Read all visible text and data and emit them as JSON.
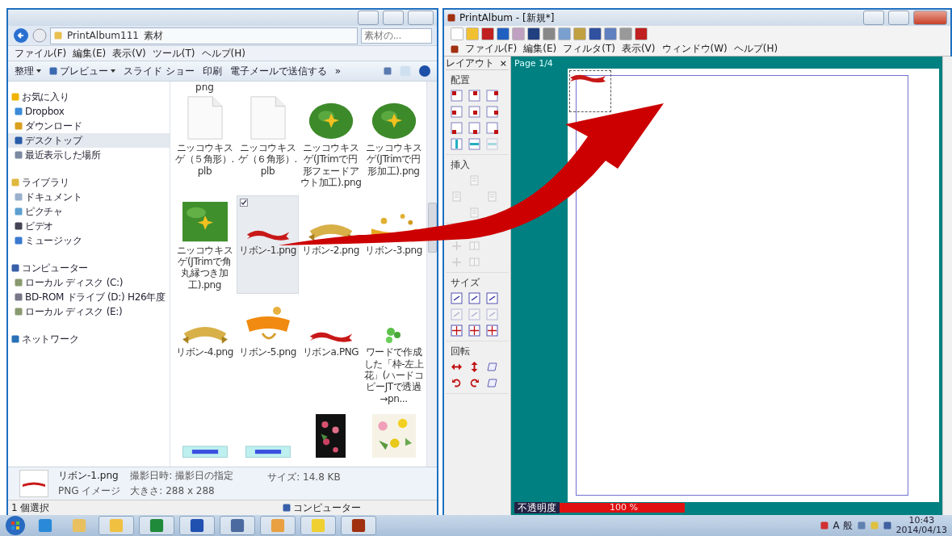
{
  "explorer": {
    "breadcrumb": [
      "PrintAlbum111",
      "素材"
    ],
    "search": {
      "placeholder": "素材の..."
    },
    "menu": [
      "ファイル(F)",
      "編集(E)",
      "表示(V)",
      "ツール(T)",
      "ヘルプ(H)"
    ],
    "commands": [
      {
        "label": "整理",
        "dropdown": true,
        "icon": false
      },
      {
        "label": "プレビュー",
        "dropdown": true,
        "icon": true
      },
      {
        "label": "スライド ショー",
        "dropdown": false,
        "icon": false
      },
      {
        "label": "印刷",
        "dropdown": false,
        "icon": false
      },
      {
        "label": "電子メールで送信する",
        "dropdown": false,
        "icon": false
      },
      {
        "label": "»",
        "dropdown": false,
        "icon": false
      }
    ],
    "nav": [
      {
        "label": "お気に入り",
        "kind": "star",
        "selected": false,
        "children": [
          {
            "label": "Dropbox",
            "kind": "dropbox",
            "selected": false
          },
          {
            "label": "ダウンロード",
            "kind": "download",
            "selected": false
          },
          {
            "label": "デスクトップ",
            "kind": "desktop",
            "selected": true
          },
          {
            "label": "最近表示した場所",
            "kind": "recent",
            "selected": false
          }
        ]
      },
      {
        "label": "ライブラリ",
        "kind": "library",
        "selected": false,
        "children": [
          {
            "label": "ドキュメント",
            "kind": "doc",
            "selected": false
          },
          {
            "label": "ピクチャ",
            "kind": "pic",
            "selected": false
          },
          {
            "label": "ビデオ",
            "kind": "video",
            "selected": false
          },
          {
            "label": "ミュージック",
            "kind": "music",
            "selected": false
          }
        ]
      },
      {
        "label": "コンピューター",
        "kind": "computer",
        "selected": false,
        "children": [
          {
            "label": "ローカル ディスク (C:)",
            "kind": "disk",
            "selected": false
          },
          {
            "label": "BD-ROM ドライブ (D:) H26年度",
            "kind": "bd",
            "selected": false
          },
          {
            "label": "ローカル ディスク (E:)",
            "kind": "disk",
            "selected": false
          }
        ]
      },
      {
        "label": "ネットワーク",
        "kind": "network",
        "selected": false
      }
    ],
    "partial_label": "png",
    "files": [
      {
        "name": "ニッコウキスゲ（５角形）.plb",
        "kind": "document",
        "selected": false
      },
      {
        "name": "ニッコウキスゲ（６角形）.plb",
        "kind": "document",
        "selected": false
      },
      {
        "name": "ニッコウキスゲ(JTrimで円形フェードアウト加工).png",
        "kind": "photo-oval",
        "selected": false
      },
      {
        "name": "ニッコウキスゲ(JTrimで円形加工).png",
        "kind": "photo-oval",
        "selected": false
      },
      {
        "name": "ニッコウキスゲ(JTrimで角丸縁つき加工).png",
        "selected": false
      },
      {
        "name": "リボン-1.png",
        "kind": "ribbon-red",
        "selected": true
      },
      {
        "name": "リボン-2.png",
        "kind": "ribbon-gold",
        "selected": false
      },
      {
        "name": "リボン-3.png",
        "kind": "ribbon-sparkle",
        "selected": false
      },
      {
        "name": "リボン-4.png",
        "kind": "ribbon-gold",
        "selected": false
      },
      {
        "name": "リボン-5.png",
        "kind": "ribbon-orange",
        "selected": false
      },
      {
        "name": "リボンa.PNG",
        "kind": "ribbon-red",
        "selected": false
      },
      {
        "name": "ワードで作成した「枠-左上花」(ハードコピーJTで透過→pn...",
        "kind": "leaf",
        "selected": false
      },
      {
        "kind": "banner",
        "selected": false
      },
      {
        "kind": "banner",
        "selected": false
      },
      {
        "kind": "flowers-dark",
        "selected": false
      },
      {
        "kind": "flowers-light",
        "selected": false
      }
    ],
    "details": {
      "name": "リボン-1.png",
      "type": "PNG イメージ",
      "fields": [
        {
          "label": "撮影日時:",
          "value": "撮影日の指定"
        },
        {
          "label": "大きさ:",
          "value": "288 x 288"
        },
        {
          "label": "サイズ:",
          "value": "14.8 KB"
        }
      ]
    },
    "status": {
      "selection": "1 個選択",
      "location": "コンピューター"
    }
  },
  "printalbum": {
    "title": "PrintAlbum - [新規*]",
    "menu": [
      "ファイル(F)",
      "編集(E)",
      "フィルタ(T)",
      "表示(V)",
      "ウィンドウ(W)",
      "ヘルプ(H)"
    ],
    "panel": {
      "title": "レイアウト",
      "close": "×",
      "sections": [
        {
          "title": "配置",
          "tools": [
            {
              "kind": "align",
              "disabled": false
            },
            {
              "kind": "align",
              "disabled": false
            },
            {
              "kind": "align",
              "disabled": false
            },
            {
              "kind": "align",
              "disabled": false
            },
            {
              "kind": "align",
              "disabled": false
            },
            {
              "kind": "align",
              "disabled": false
            },
            {
              "kind": "align",
              "disabled": false
            },
            {
              "kind": "align",
              "disabled": false
            },
            {
              "kind": "align",
              "disabled": false
            },
            {
              "kind": "center",
              "disabled": false
            },
            {
              "kind": "center",
              "disabled": false
            },
            {
              "kind": "center",
              "disabled": true
            }
          ]
        },
        {
          "title": "挿入",
          "kind": "diamond",
          "tools": [
            {
              "kind": "insert",
              "disabled": true
            },
            {
              "kind": "insert",
              "disabled": true
            },
            {
              "kind": "insert",
              "disabled": true
            },
            {
              "kind": "insert",
              "disabled": true
            }
          ]
        },
        {
          "kind": "under-arrow",
          "tools": [
            {
              "kind": "move",
              "disabled": true
            },
            {
              "kind": "split",
              "disabled": true
            },
            {
              "kind": "move",
              "disabled": true
            },
            {
              "kind": "split",
              "disabled": true
            }
          ]
        },
        {
          "title": "サイズ",
          "tools": [
            {
              "kind": "size",
              "disabled": false
            },
            {
              "kind": "size",
              "disabled": false
            },
            {
              "kind": "size",
              "disabled": false
            },
            {
              "kind": "size",
              "disabled": true
            },
            {
              "kind": "size",
              "disabled": true
            },
            {
              "kind": "size",
              "disabled": true
            },
            {
              "kind": "fit",
              "disabled": false
            },
            {
              "kind": "fit",
              "disabled": false
            },
            {
              "kind": "fit",
              "disabled": false
            }
          ]
        },
        {
          "title": "回転",
          "tools": [
            {
              "kind": "flip-h",
              "disabled": false
            },
            {
              "kind": "flip-v",
              "disabled": false
            },
            {
              "kind": "skew",
              "disabled": false
            },
            {
              "kind": "rotate-left",
              "disabled": false
            },
            {
              "kind": "rotate-right",
              "disabled": false
            },
            {
              "kind": "skew",
              "disabled": false
            }
          ]
        }
      ]
    },
    "page_tab": "Page 1/4",
    "opacity": {
      "label": "不透明度",
      "reading": "100 %",
      "level": 1
    }
  },
  "taskbar": {
    "apps": [
      {
        "kind": "ie",
        "selected": false
      },
      {
        "kind": "mail",
        "selected": false
      },
      {
        "kind": "folder",
        "selected": true
      },
      {
        "kind": "excel",
        "selected": true
      },
      {
        "kind": "word",
        "selected": true
      },
      {
        "kind": "s",
        "selected": true
      },
      {
        "kind": "orange",
        "selected": true
      },
      {
        "kind": "help",
        "selected": true
      },
      {
        "kind": "printalbum",
        "selected": true
      }
    ],
    "ime": "A 般",
    "time": "10:43",
    "date": "2014/04/13"
  }
}
